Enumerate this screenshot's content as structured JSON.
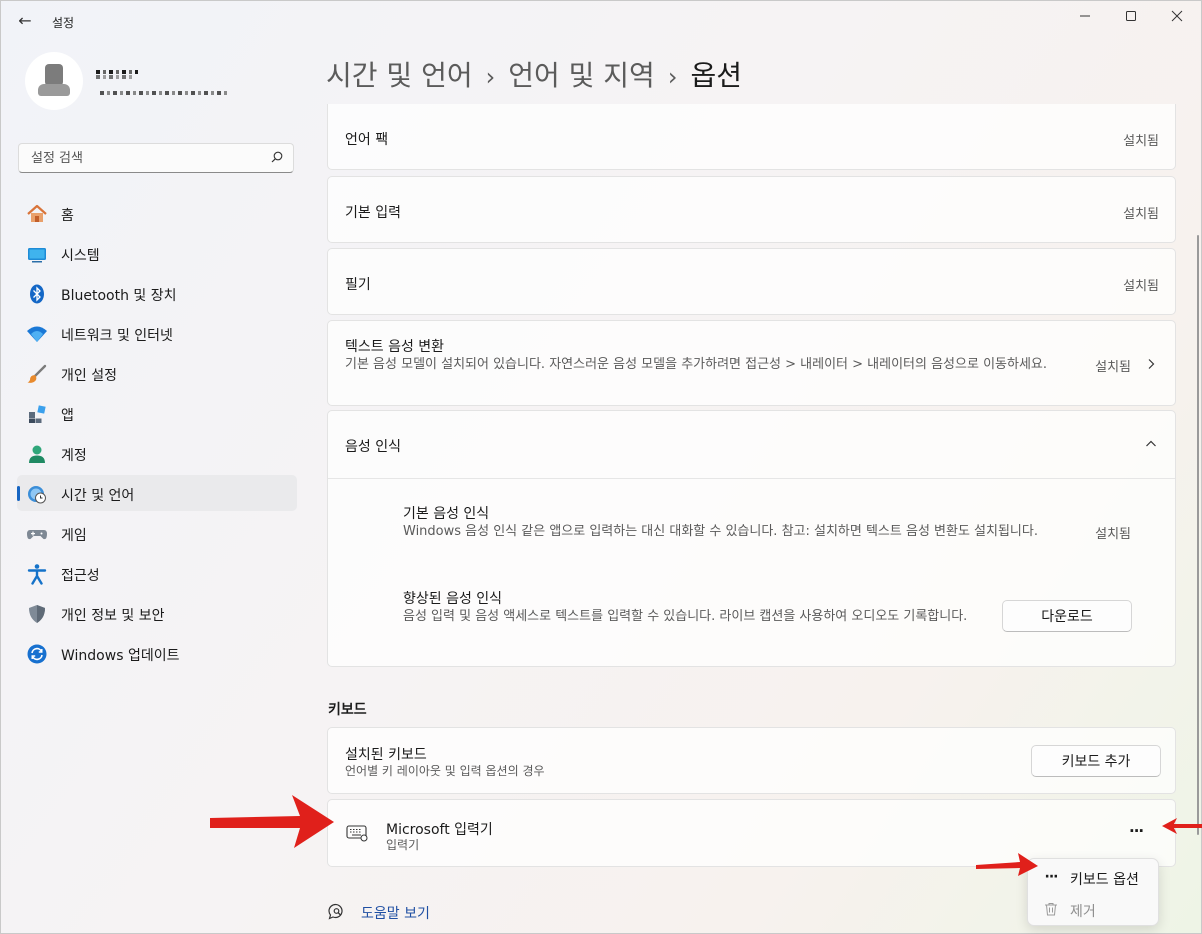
{
  "window": {
    "title": "설정",
    "back_glyph": "←",
    "minimize": "—",
    "maximize": "☐",
    "close": "✕"
  },
  "colors": {
    "accent": "#1765c2",
    "annotation_arrow": "#e0201b",
    "link": "#1f4fa3"
  },
  "search": {
    "placeholder": "설정 검색",
    "icon": "search-icon"
  },
  "nav": {
    "items": [
      {
        "label": "홈",
        "icon": "home-icon"
      },
      {
        "label": "시스템",
        "icon": "system-icon"
      },
      {
        "label": "Bluetooth 및 장치",
        "icon": "bluetooth-icon"
      },
      {
        "label": "네트워크 및 인터넷",
        "icon": "wifi-icon"
      },
      {
        "label": "개인 설정",
        "icon": "brush-icon"
      },
      {
        "label": "앱",
        "icon": "apps-icon"
      },
      {
        "label": "계정",
        "icon": "account-icon"
      },
      {
        "label": "시간 및 언어",
        "icon": "time-language-icon",
        "active": true
      },
      {
        "label": "게임",
        "icon": "gamepad-icon"
      },
      {
        "label": "접근성",
        "icon": "accessibility-icon"
      },
      {
        "label": "개인 정보 및 보안",
        "icon": "shield-icon"
      },
      {
        "label": "Windows 업데이트",
        "icon": "windows-update-icon"
      }
    ]
  },
  "breadcrumb": {
    "level1": "시간 및 언어",
    "level2": "언어 및 지역",
    "current": "옵션",
    "sep": "›"
  },
  "features": {
    "language_pack": {
      "title": "언어 팩",
      "status": "설치됨"
    },
    "basic_typing": {
      "title": "기본 입력",
      "status": "설치됨"
    },
    "handwriting": {
      "title": "필기",
      "status": "설치됨"
    },
    "tts": {
      "title": "텍스트 음성 변환",
      "desc": "기본 음성 모델이 설치되어 있습니다. 자연스러운 음성 모델을 추가하려면 접근성 > 내레이터 > 내레이터의 음성으로 이동하세요.",
      "status": "설치됨"
    },
    "speech": {
      "title": "음성 인식",
      "basic": {
        "title": "기본 음성 인식",
        "desc": "Windows 음성 인식 같은 앱으로 입력하는 대신 대화할 수 있습니다. 참고: 설치하면 텍스트 음성 변환도 설치됩니다.",
        "status": "설치됨"
      },
      "enhanced": {
        "title": "향상된 음성 인식",
        "desc": "음성 입력 및 음성 액세스로 텍스트를 입력할 수 있습니다. 라이브 캡션을 사용하여 오디오도 기록합니다.",
        "button": "다운로드"
      }
    }
  },
  "keyboard": {
    "heading": "키보드",
    "installed": {
      "title": "설치된 키보드",
      "desc": "언어별 키 레이아웃 및 입력 옵션의 경우",
      "button": "키보드 추가"
    },
    "ime": {
      "title": "Microsoft 입력기",
      "subtitle": "입력기",
      "more": "···"
    }
  },
  "menu": {
    "items": [
      {
        "label": "키보드 옵션",
        "icon": "···"
      },
      {
        "label": "제거",
        "icon": "trash-icon"
      }
    ]
  },
  "help": {
    "label": "도움말 보기"
  }
}
